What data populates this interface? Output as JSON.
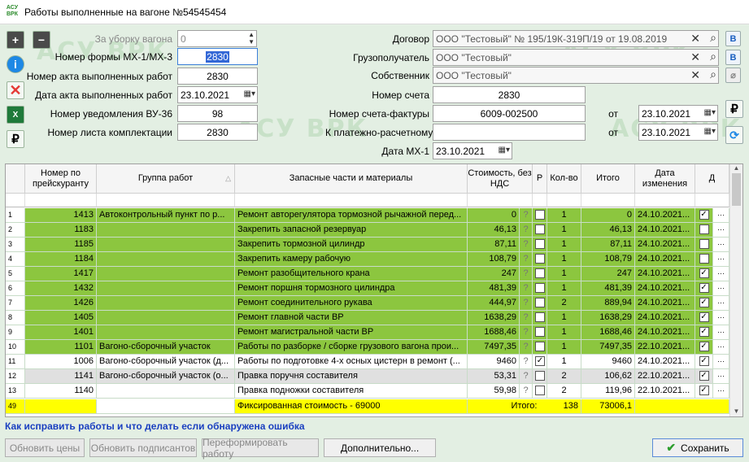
{
  "window": {
    "title": "Работы выполненные на вагоне №54545454",
    "logo": "АСУ ВРК"
  },
  "watermark": "АСУ ВРК",
  "form": {
    "cleaning_label": "За уборку вагона",
    "cleaning_value": "0",
    "mx_form_label": "Номер формы МХ-1/МХ-3",
    "mx_form_value": "2830",
    "act_number_label": "Номер акта выполненных работ",
    "act_number_value": "2830",
    "act_date_label": "Дата акта выполненных работ",
    "act_date_value": "23.10.2021",
    "vu36_label": "Номер уведомления ВУ-36",
    "vu36_value": "98",
    "kit_label": "Номер листа комплектации",
    "kit_value": "2830",
    "contract_label": "Договор",
    "contract_value": "ООО \"Тестовый\"  № 195/19К-319П/19 от 19.08.2019",
    "consignee_label": "Грузополучатель",
    "consignee_value": "ООО \"Тестовый\"",
    "owner_label": "Собственник",
    "owner_value": "ООО \"Тестовый\"",
    "invoice_label": "Номер счета",
    "invoice_value": "2830",
    "tax_invoice_label": "Номер счета-фактуры",
    "tax_invoice_value": "6009-002500",
    "payment_label": "К платежно-расчетному",
    "payment_value": "",
    "from_label": "от",
    "tax_invoice_date": "23.10.2021",
    "payment_date": "23.10.2021",
    "mx1_date_label": "Дата МХ-1",
    "mx1_date_value": "23.10.2021"
  },
  "grid": {
    "columns": [
      "Номер по прейскуранту",
      "Группа работ",
      "Запасные части и материалы",
      "Стоимость, без НДС",
      "Р",
      "Кол-во",
      "Итого",
      "Дата изменения",
      "Д"
    ],
    "rows": [
      {
        "n": "1",
        "code": "1413",
        "group": "Автоконтрольный пункт по р...",
        "part": "Ремонт авторегулятора тормозной рычажной перед...",
        "cost": "0",
        "r": false,
        "qty": "1",
        "total": "0",
        "date": "24.10.2021...",
        "d": true,
        "style": "g"
      },
      {
        "n": "2",
        "code": "1183",
        "group": "",
        "part": "Закрепить запасной резервуар",
        "cost": "46,13",
        "r": false,
        "qty": "1",
        "total": "46,13",
        "date": "24.10.2021...",
        "d": false,
        "style": "g"
      },
      {
        "n": "3",
        "code": "1185",
        "group": "",
        "part": "Закрепить тормозной цилиндр",
        "cost": "87,11",
        "r": false,
        "qty": "1",
        "total": "87,11",
        "date": "24.10.2021...",
        "d": false,
        "style": "g"
      },
      {
        "n": "4",
        "code": "1184",
        "group": "",
        "part": "Закрепить камеру рабочую",
        "cost": "108,79",
        "r": false,
        "qty": "1",
        "total": "108,79",
        "date": "24.10.2021...",
        "d": false,
        "style": "g"
      },
      {
        "n": "5",
        "code": "1417",
        "group": "",
        "part": "Ремонт разобщительного крана",
        "cost": "247",
        "r": false,
        "qty": "1",
        "total": "247",
        "date": "24.10.2021...",
        "d": true,
        "style": "g"
      },
      {
        "n": "6",
        "code": "1432",
        "group": "",
        "part": "Ремонт поршня тормозного цилиндра",
        "cost": "481,39",
        "r": false,
        "qty": "1",
        "total": "481,39",
        "date": "24.10.2021...",
        "d": true,
        "style": "g"
      },
      {
        "n": "7",
        "code": "1426",
        "group": "",
        "part": "Ремонт соединительного рукава",
        "cost": "444,97",
        "r": false,
        "qty": "2",
        "total": "889,94",
        "date": "24.10.2021...",
        "d": true,
        "style": "g"
      },
      {
        "n": "8",
        "code": "1405",
        "group": "",
        "part": "Ремонт главной части ВР",
        "cost": "1638,29",
        "r": false,
        "qty": "1",
        "total": "1638,29",
        "date": "24.10.2021...",
        "d": true,
        "style": "g"
      },
      {
        "n": "9",
        "code": "1401",
        "group": "",
        "part": "Ремонт магистральной части ВР",
        "cost": "1688,46",
        "r": false,
        "qty": "1",
        "total": "1688,46",
        "date": "24.10.2021...",
        "d": true,
        "style": "g"
      },
      {
        "n": "10",
        "code": "1101",
        "group": "Вагоно-сборочный участок",
        "part": "Работы по разборке / сборке грузового вагона прои...",
        "cost": "7497,35",
        "r": false,
        "qty": "1",
        "total": "7497,35",
        "date": "22.10.2021...",
        "d": true,
        "style": "g"
      },
      {
        "n": "11",
        "code": "1006",
        "group": "Вагоно-сборочный участок (д...",
        "part": "Работы по подготовке 4-х осных цистерн в ремонт (...",
        "cost": "9460",
        "r": true,
        "qty": "1",
        "total": "9460",
        "date": "24.10.2021...",
        "d": true,
        "style": "w"
      },
      {
        "n": "12",
        "code": "1141",
        "group": "Вагоно-сборочный участок (о...",
        "part": "Правка поручня составителя",
        "cost": "53,31",
        "r": false,
        "qty": "2",
        "total": "106,62",
        "date": "22.10.2021...",
        "d": true,
        "style": "sel"
      },
      {
        "n": "13",
        "code": "1140",
        "group": "",
        "part": "Правка подножки составителя",
        "cost": "59,98",
        "r": false,
        "qty": "2",
        "total": "119,96",
        "date": "22.10.2021...",
        "d": true,
        "style": "w"
      }
    ],
    "footer": {
      "count": "49",
      "fixed": "Фиксированная стоимость - 69000",
      "total_label": "Итого:",
      "qty": "138",
      "total": "73006,1"
    }
  },
  "help_link": "Как исправить работы и что делать если обнаружена ошибка",
  "buttons": {
    "update_prices": "Обновить цены",
    "update_signers": "Обновить подписантов",
    "reform": "Переформировать работу",
    "more": "Дополнительно...",
    "save": "Сохранить"
  }
}
